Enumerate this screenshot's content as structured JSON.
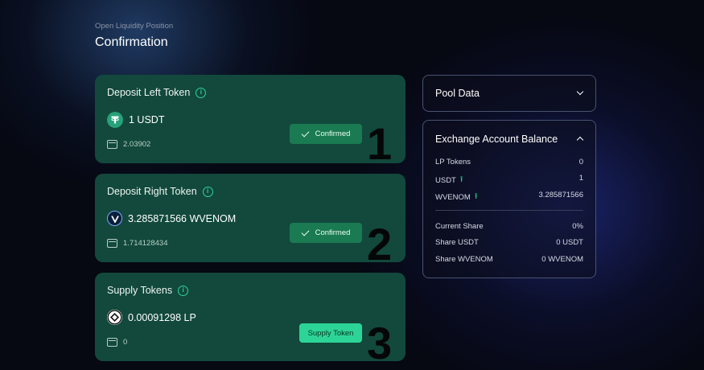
{
  "header": {
    "subtitle": "Open Liquidity Position",
    "title": "Confirmation"
  },
  "cards": [
    {
      "title": "Deposit Left Token",
      "amount": "1 USDT",
      "balance": "2.03902",
      "button": "Confirmed",
      "step": "1",
      "icon": "usdt-icon"
    },
    {
      "title": "Deposit Right Token",
      "amount": "3.285871566 WVENOM",
      "balance": "1.714128434",
      "button": "Confirmed",
      "step": "2",
      "icon": "venom-icon"
    },
    {
      "title": "Supply Tokens",
      "amount": "0.00091298 LP",
      "balance": "0",
      "button": "Supply Token",
      "step": "3",
      "icon": "lp-token-icon"
    }
  ],
  "pool_data": {
    "title": "Pool Data"
  },
  "exchange": {
    "title": "Exchange Account Balance",
    "rows": [
      {
        "label": "LP Tokens",
        "value": "0"
      },
      {
        "label": "USDT",
        "value": "1"
      },
      {
        "label": "WVENOM",
        "value": "3.285871566"
      }
    ],
    "share_rows": [
      {
        "label": "Current Share",
        "value": "0%"
      },
      {
        "label": "Share USDT",
        "value": "0 USDT"
      },
      {
        "label": "Share WVENOM",
        "value": "0 WVENOM"
      }
    ]
  },
  "colors": {
    "card_bg": "#12493c",
    "accent": "#2dd497",
    "confirmed_bg": "#1a7a52",
    "panel_border": "#4a5270"
  }
}
